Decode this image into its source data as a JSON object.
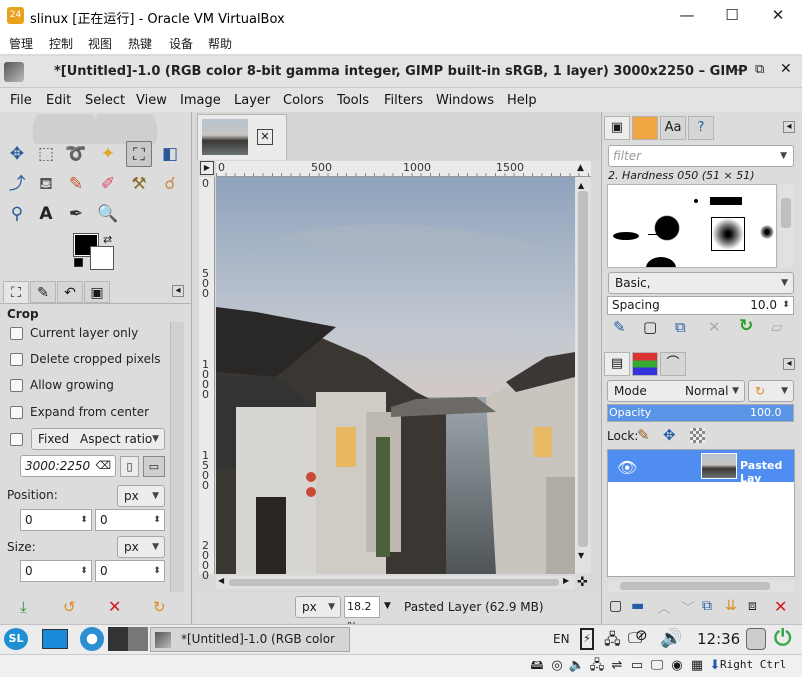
{
  "vbox": {
    "title": "slinux [正在运行] - Oracle VM VirtualBox",
    "menu": [
      "管理",
      "控制",
      "视图",
      "热键",
      "设备",
      "帮助"
    ],
    "win_min": "—",
    "win_max": "☐",
    "win_close": "✕"
  },
  "gimp": {
    "title": "*[Untitled]-1.0 (RGB color 8-bit gamma integer, GIMP built-in sRGB, 1 layer) 3000x2250 – GIMP",
    "menu": [
      "File",
      "Edit",
      "Select",
      "View",
      "Image",
      "Layer",
      "Colors",
      "Tools",
      "Filters",
      "Windows",
      "Help"
    ],
    "tool_options": {
      "heading": "Crop",
      "current_layer_only": "Current layer only",
      "delete_cropped": "Delete cropped pixels",
      "allow_growing": "Allow growing",
      "expand_center": "Expand from center",
      "fixed": "Fixed",
      "aspect_mode": "Aspect ratio",
      "ratio_value": "3000:2250",
      "position_label": "Position:",
      "size_label": "Size:",
      "unit": "px",
      "pos_x": "0",
      "pos_y": "0",
      "size_w": "0",
      "size_h": "0"
    },
    "ruler": {
      "h_ticks": [
        "0",
        "500",
        "1000",
        "1500"
      ],
      "v_ticks": [
        "0",
        "500",
        "1000",
        "1500",
        "2000"
      ]
    },
    "status": {
      "unit": "px",
      "zoom": "18.2 %",
      "layer_info": "Pasted Layer (62.9 MB)"
    },
    "brushes": {
      "filter_placeholder": "filter",
      "current_brush": "2. Hardness 050 (51 × 51)",
      "tag": "Basic,",
      "spacing_label": "Spacing",
      "spacing_value": "10.0"
    },
    "layers": {
      "mode_label": "Mode",
      "mode_value": "Normal",
      "opacity_label": "Opacity",
      "opacity_value": "100.0",
      "opacity": 1.0,
      "lock_label": "Lock:",
      "layer_name": "Pasted Lay"
    }
  },
  "taskbar": {
    "window_button": "*[Untitled]-1.0 (RGB color ...",
    "lang": "EN",
    "clock": "12:36"
  },
  "vbstatus": {
    "host_key": "Right Ctrl"
  },
  "colors": {
    "selection_blue": "#4f8ef0",
    "opacity_blue": "#5a94e6",
    "delete_red": "#d41b1b",
    "refresh_green": "#2aa02a"
  }
}
